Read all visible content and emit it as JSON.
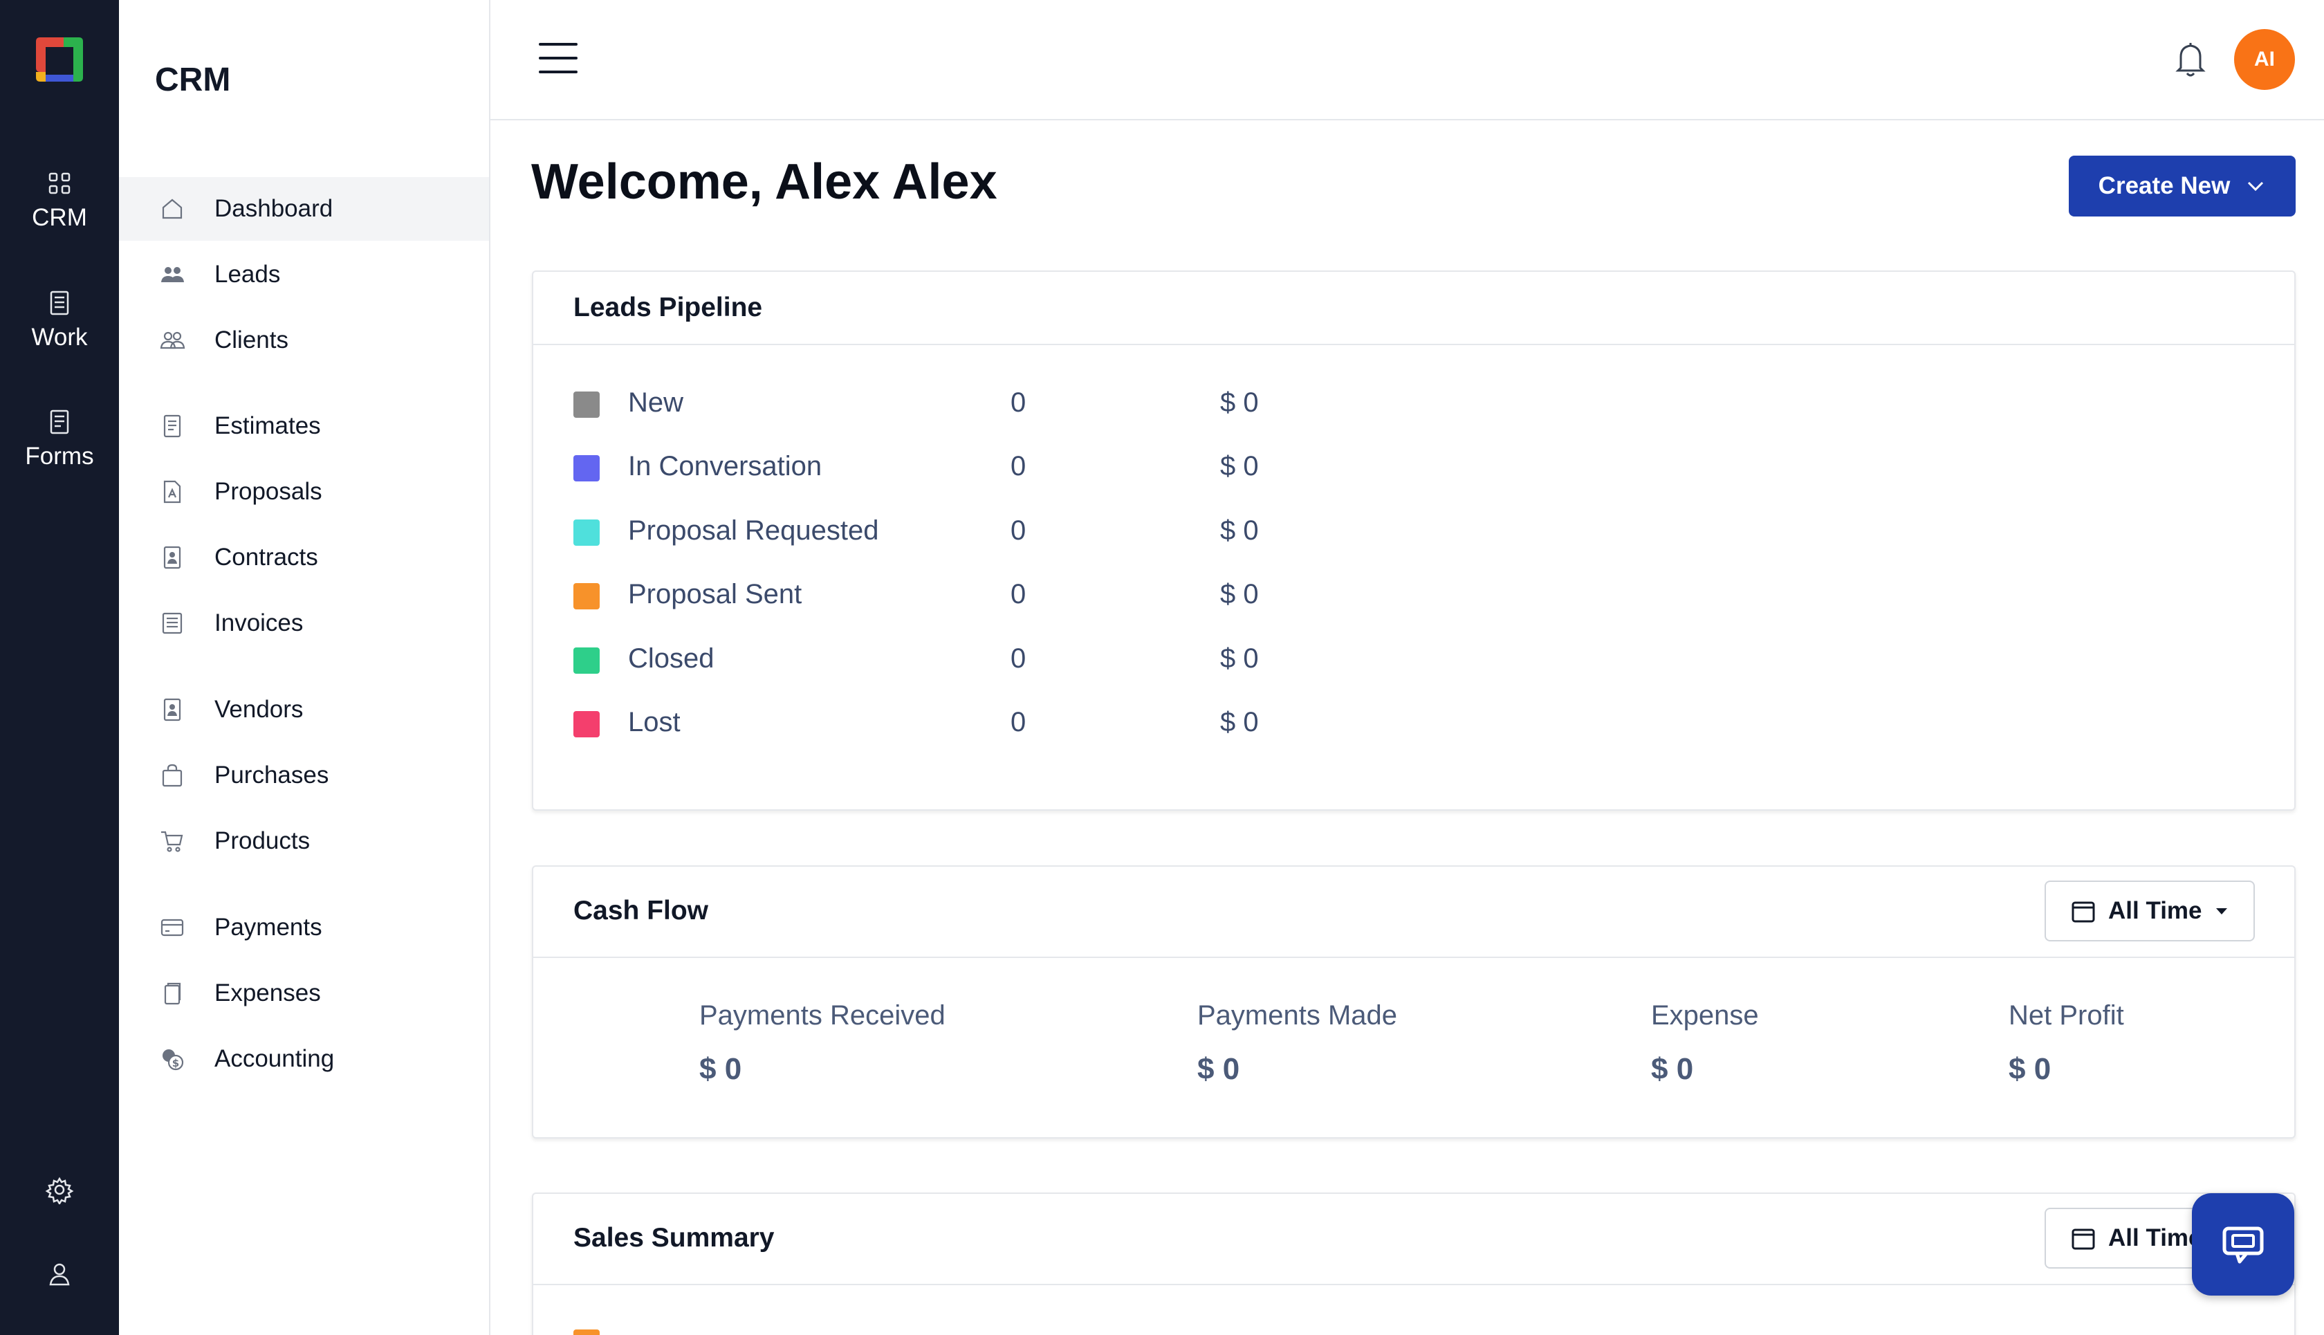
{
  "rail": {
    "items": [
      {
        "label": "CRM",
        "icon": "grid-icon"
      },
      {
        "label": "Work",
        "icon": "work-icon"
      },
      {
        "label": "Forms",
        "icon": "forms-icon"
      }
    ],
    "bottom": [
      {
        "icon": "gear-icon"
      },
      {
        "icon": "user-icon"
      }
    ]
  },
  "sidebar": {
    "title": "CRM",
    "items": [
      {
        "label": "Dashboard",
        "icon": "home-icon",
        "active": true
      },
      {
        "label": "Leads",
        "icon": "leads-icon"
      },
      {
        "label": "Clients",
        "icon": "clients-icon"
      },
      {
        "label": "Estimates",
        "icon": "estimates-icon"
      },
      {
        "label": "Proposals",
        "icon": "proposals-icon"
      },
      {
        "label": "Contracts",
        "icon": "contracts-icon"
      },
      {
        "label": "Invoices",
        "icon": "invoices-icon"
      },
      {
        "label": "Vendors",
        "icon": "vendors-icon"
      },
      {
        "label": "Purchases",
        "icon": "bag-icon"
      },
      {
        "label": "Products",
        "icon": "cart-icon"
      },
      {
        "label": "Payments",
        "icon": "card-icon"
      },
      {
        "label": "Expenses",
        "icon": "expenses-icon"
      },
      {
        "label": "Accounting",
        "icon": "accounting-icon"
      }
    ]
  },
  "topbar": {
    "avatar_initials": "AI"
  },
  "main": {
    "welcome": "Welcome, Alex Alex",
    "create_label": "Create New"
  },
  "pipeline": {
    "title": "Leads Pipeline",
    "rows": [
      {
        "label": "New",
        "count": "0",
        "amount": "$ 0",
        "color": "#8a8a8a"
      },
      {
        "label": "In Conversation",
        "count": "0",
        "amount": "$ 0",
        "color": "#6366f1"
      },
      {
        "label": "Proposal Requested",
        "count": "0",
        "amount": "$ 0",
        "color": "#4fe0dc"
      },
      {
        "label": "Proposal Sent",
        "count": "0",
        "amount": "$ 0",
        "color": "#f7922a"
      },
      {
        "label": "Closed",
        "count": "0",
        "amount": "$ 0",
        "color": "#2ecf8a"
      },
      {
        "label": "Lost",
        "count": "0",
        "amount": "$ 0",
        "color": "#f43f6d"
      }
    ]
  },
  "cashflow": {
    "title": "Cash Flow",
    "filter": "All Time",
    "metrics": [
      {
        "label": "Payments Received",
        "value": "$ 0"
      },
      {
        "label": "Payments Made",
        "value": "$ 0"
      },
      {
        "label": "Expense",
        "value": "$ 0"
      },
      {
        "label": "Net Profit",
        "value": "$ 0"
      }
    ]
  },
  "sales": {
    "title": "Sales Summary",
    "filter": "All Time"
  },
  "colors": {
    "accent": "#1e3fae",
    "avatar": "#f97316",
    "rail": "#141a2b"
  }
}
